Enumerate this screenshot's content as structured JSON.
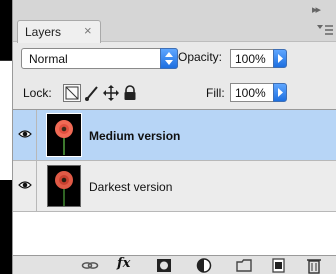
{
  "panel": {
    "tab_label": "Layers",
    "tab_close": "×",
    "collapse_glyph": "▸▸"
  },
  "controls": {
    "blend_mode": "Normal",
    "opacity_label": "Opacity:",
    "opacity_value": "100%",
    "lock_label": "Lock:",
    "fill_label": "Fill:",
    "fill_value": "100%"
  },
  "layers": [
    {
      "name": "Medium version",
      "selected": true,
      "visible": true
    },
    {
      "name": "Darkest version",
      "selected": false,
      "visible": true
    }
  ],
  "toolbar_icons": [
    "link-layers-icon",
    "fx-icon",
    "add-mask-icon",
    "adjustment-layer-icon",
    "new-group-icon",
    "new-layer-icon",
    "trash-icon"
  ],
  "fx_text": "fx",
  "colors": {
    "selection": "#b7d5f6",
    "stepper_accent": "#1d6fe0",
    "flower": "#f06a55"
  }
}
